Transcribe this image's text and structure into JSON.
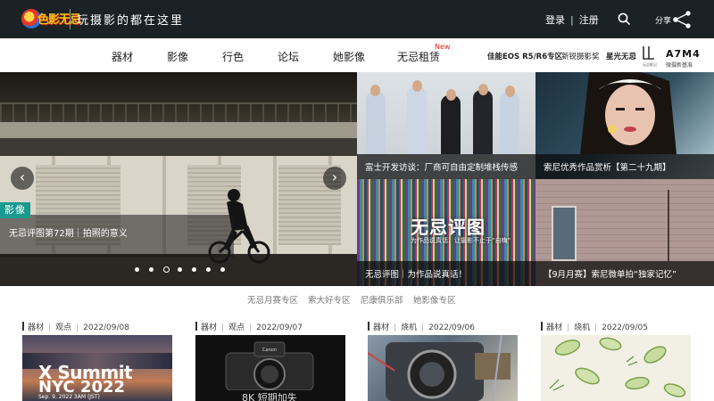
{
  "header": {
    "logo_text": "色影无忌",
    "slogan": "玩摄影的都在这里",
    "login": "登录",
    "register": "注册",
    "share": "分享"
  },
  "nav": {
    "items": [
      "器材",
      "影像",
      "行色",
      "论坛",
      "她影像",
      "无忌租赁"
    ],
    "new_badge": "New",
    "promos": [
      "佳能EOS R5/R6专区",
      "新锐摄影奖",
      "星光无忌"
    ],
    "a7_title": "A7M4",
    "a7_sub": "微摄新基准",
    "a7_logo_caption": "无忌影记"
  },
  "hero": {
    "tag": "影像",
    "caption": "无忌评图第72期｜拍照的意义",
    "slide_count": 7,
    "active_slide": 3
  },
  "tiles": [
    {
      "caption": "富士开发访谈：厂商可自由定制堆栈传感"
    },
    {
      "caption": "索尼优秀作品赏析【第二十九期】"
    },
    {
      "caption": "无忌评图｜为作品说真话！",
      "logo": "无忌评图",
      "sub": "为作品说真话，让摄影不止于“自嗨”"
    },
    {
      "caption": "【9月月赛】索尼微单拍“独家记忆”"
    }
  ],
  "sublinks": [
    "无忌月赛专区",
    "索大好专区",
    "尼康俱乐部",
    "她影像专区"
  ],
  "cards": [
    {
      "cat": "器材",
      "sub": "观点",
      "date": "2022/09/08",
      "title1": "X Summit",
      "title2": "NYC 2022",
      "note": "Sep. 9, 2022 3AM (JST)"
    },
    {
      "cat": "器材",
      "sub": "观点",
      "date": "2022/09/07",
      "text": "8K 短期加失",
      "brand": "Canon"
    },
    {
      "cat": "器材",
      "sub": "烧机",
      "date": "2022/09/06"
    },
    {
      "cat": "器材",
      "sub": "烧机",
      "date": "2022/09/05"
    }
  ]
}
